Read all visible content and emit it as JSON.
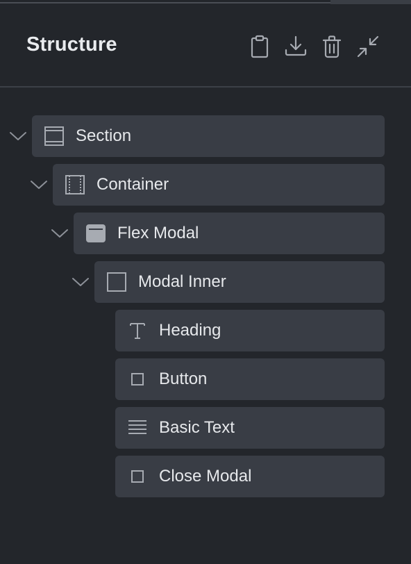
{
  "panel": {
    "title": "Structure"
  },
  "header_actions": [
    {
      "name": "copy-clipboard-icon"
    },
    {
      "name": "download-icon"
    },
    {
      "name": "trash-icon"
    },
    {
      "name": "collapse-icon"
    }
  ],
  "tree": [
    {
      "label": "Section",
      "icon": "section-icon",
      "expanded": true,
      "depth": 0
    },
    {
      "label": "Container",
      "icon": "container-icon",
      "expanded": true,
      "depth": 1
    },
    {
      "label": "Flex Modal",
      "icon": "modal-icon",
      "expanded": true,
      "depth": 2
    },
    {
      "label": "Modal Inner",
      "icon": "square-outline-icon",
      "expanded": true,
      "depth": 3
    },
    {
      "label": "Heading",
      "icon": "text-t-icon",
      "depth": 4
    },
    {
      "label": "Button",
      "icon": "small-square-icon",
      "depth": 4
    },
    {
      "label": "Basic Text",
      "icon": "lines-icon",
      "depth": 4
    },
    {
      "label": "Close Modal",
      "icon": "small-square-icon",
      "depth": 4
    }
  ],
  "colors": {
    "background": "#23262b",
    "node_background": "#393d45",
    "text": "#e6e8eb",
    "icon": "#a7abb2"
  }
}
